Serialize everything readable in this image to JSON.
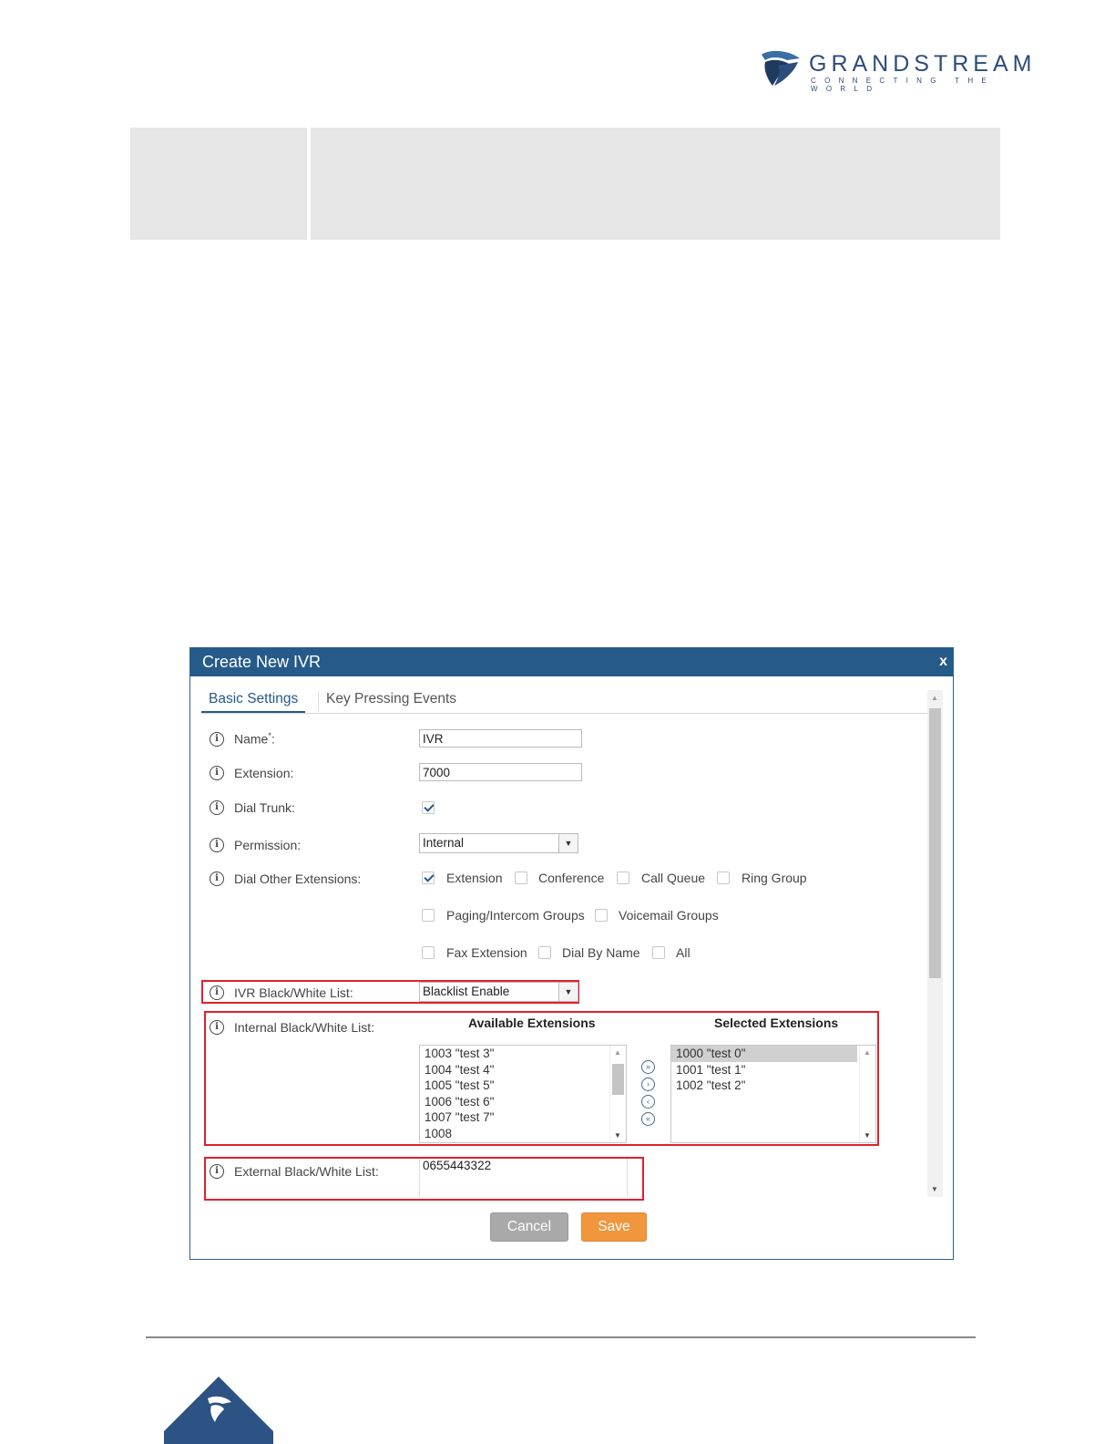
{
  "header": {
    "brand": "GRANDSTREAM",
    "tagline": "CONNECTING THE WORLD"
  },
  "dialog": {
    "title": "Create New IVR",
    "close_label": "x",
    "tabs": [
      {
        "label": "Basic Settings",
        "active": true
      },
      {
        "label": "Key Pressing Events",
        "active": false
      }
    ],
    "fields": {
      "name": {
        "label": "Name",
        "required_mark": "*",
        "suffix": ":",
        "value": "IVR"
      },
      "extension": {
        "label": "Extension:",
        "value": "7000"
      },
      "dial_trunk": {
        "label": "Dial Trunk:",
        "checked": true
      },
      "permission": {
        "label": "Permission:",
        "value": "Internal"
      },
      "dial_other": {
        "label": "Dial Other Extensions:",
        "options": [
          {
            "label": "Extension",
            "checked": true
          },
          {
            "label": "Conference",
            "checked": false
          },
          {
            "label": "Call Queue",
            "checked": false
          },
          {
            "label": "Ring Group",
            "checked": false
          },
          {
            "label": "Paging/Intercom Groups",
            "checked": false
          },
          {
            "label": "Voicemail Groups",
            "checked": false
          },
          {
            "label": "Fax Extension",
            "checked": false
          },
          {
            "label": "Dial By Name",
            "checked": false
          },
          {
            "label": "All",
            "checked": false
          }
        ]
      },
      "ivr_bw": {
        "label": "IVR Black/White List:",
        "value": "Blacklist Enable"
      },
      "internal_bw": {
        "label": "Internal Black/White List:",
        "available_title": "Available Extensions",
        "selected_title": "Selected Extensions",
        "available": [
          "1003 \"test 3\"",
          "1004 \"test 4\"",
          "1005 \"test 5\"",
          "1006 \"test 6\"",
          "1007 \"test 7\"",
          "1008"
        ],
        "selected": [
          "1000 \"test 0\"",
          "1001 \"test 1\"",
          "1002 \"test 2\""
        ],
        "move_buttons": [
          "move-all-right",
          "move-right",
          "move-left",
          "move-all-left"
        ]
      },
      "external_bw": {
        "label": "External Black/White List:",
        "value": "0655443322"
      }
    },
    "buttons": {
      "cancel": "Cancel",
      "save": "Save"
    }
  },
  "colors": {
    "title_bar": "#255a89",
    "highlight_box": "#e1202d",
    "save_button": "#f0963d",
    "cancel_button": "#a9a9a9"
  }
}
